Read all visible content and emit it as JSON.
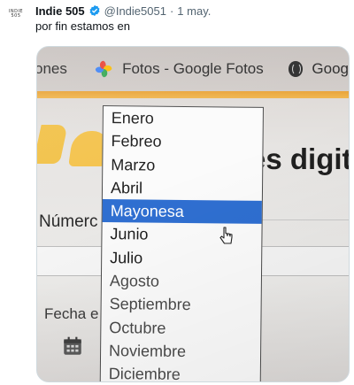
{
  "tweet": {
    "avatar_lines": [
      "INDIE",
      "505"
    ],
    "display_name": "Indie 505",
    "handle": "@Indie5051",
    "separator": "·",
    "date": "1 may.",
    "text": "por fin estamos en"
  },
  "photo": {
    "bookmarks": {
      "left_fragment": "ones",
      "photos_tab": "Fotos - Google Fotos",
      "right_fragment": "Goog"
    },
    "page_heading": "es digit",
    "number_label": "Númerc",
    "date_label": "Fecha e",
    "dropdown": {
      "selected_index": 4,
      "options": [
        "Enero",
        "Febreo",
        "Marzo",
        "Abril",
        "Mayonesa",
        "Junio",
        "Julio",
        "Agosto",
        "Septiembre",
        "Octubre",
        "Noviembre",
        "Diciembre"
      ]
    },
    "colors": {
      "accent_bar": "#e9a43a",
      "selection": "#2f6fd1",
      "verified": "#1d9bf0"
    },
    "icons": [
      "google-photos-icon",
      "globe-icon",
      "calendar-icon",
      "cursor-icon",
      "verified-icon"
    ]
  }
}
